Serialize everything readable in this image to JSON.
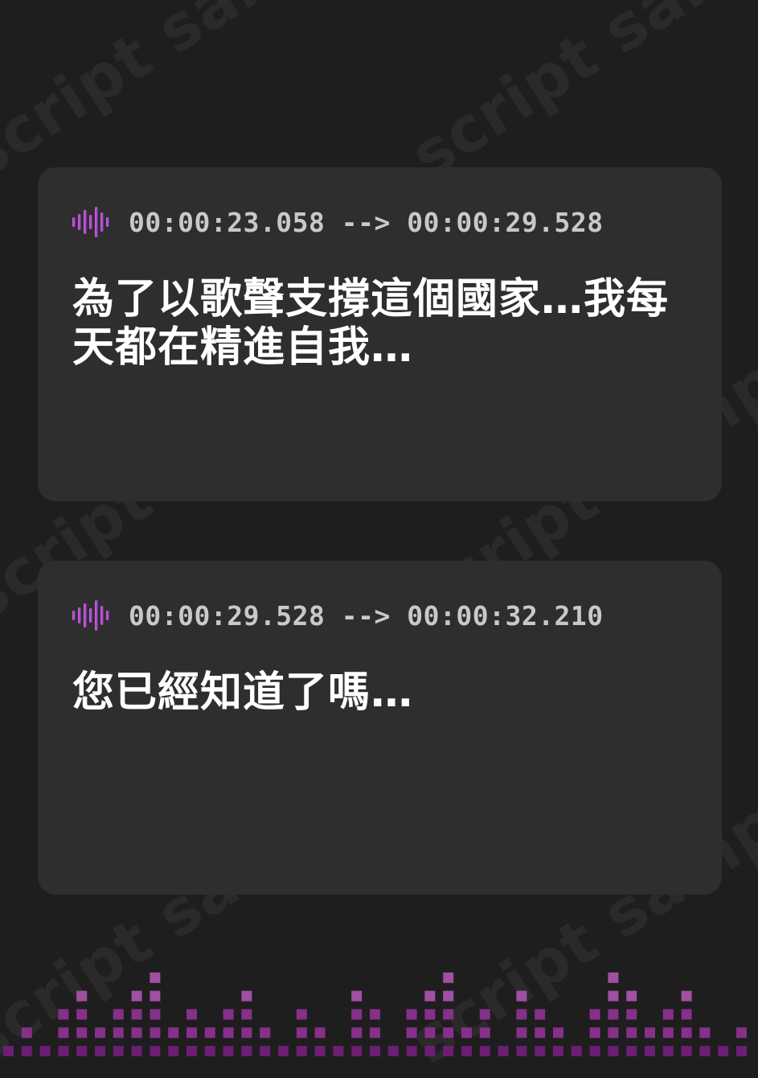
{
  "watermark_text": "script sample",
  "cues": [
    {
      "timestamp": "00:00:23.058 --> 00:00:29.528",
      "text": "為了以歌聲支撐這個國家…我每天都在精進自我…"
    },
    {
      "timestamp": "00:00:29.528 --> 00:00:32.210",
      "text": "您已經知道了嗎…"
    }
  ],
  "colors": {
    "background": "#1e1e1f",
    "card": "#2e2e2f",
    "accent_pink": "#e05cc8",
    "accent_purple": "#8a44d6",
    "equalizer_light": "#a14fa3",
    "equalizer_dark": "#6a1f72"
  },
  "icons": {
    "waveform": "audio-waveform-icon"
  }
}
